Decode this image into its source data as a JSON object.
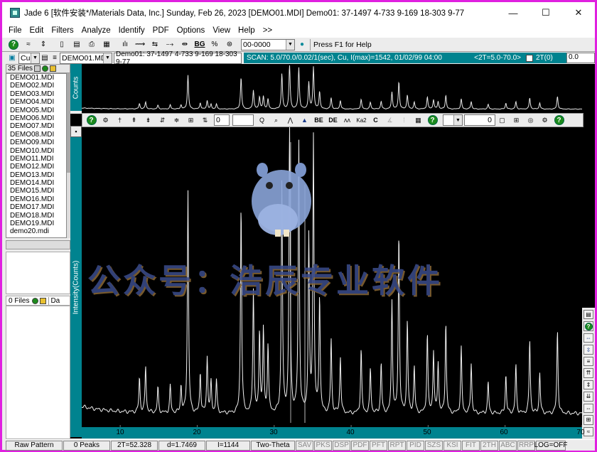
{
  "window": {
    "title": "Jade 6 [软件安装*/Materials Data, Inc.] Sunday, Feb 26, 2023 [DEMO01.MDI] Demo01: 37-1497 4-733 9-169 18-303 9-77",
    "minimize_glyph": "—",
    "maximize_glyph": "☐",
    "close_glyph": "✕"
  },
  "menu": [
    "File",
    "Edit",
    "Filters",
    "Analyze",
    "Identify",
    "PDF",
    "Options",
    "View",
    "Help",
    ">>"
  ],
  "toolbar1": {
    "pdf_combo": "00-0000",
    "hint": "Press F1 for Help",
    "button_glyphs": [
      "?",
      "≈",
      "⇕",
      "▯",
      "▤",
      "⎙",
      "▦",
      "ılı",
      "⟿",
      "⇆",
      "⤍",
      "⇹",
      "BG",
      "%",
      "⊛"
    ],
    "icons": [
      "help-icon",
      "smooth-icon",
      "zoom-vert-icon",
      "eraser-icon",
      "film-icon",
      "print-icon",
      "save-icon",
      "bar-peaks-icon",
      "fit-icon",
      "strip-icon",
      "shift-icon",
      "expand-icon",
      "background-icon",
      "percent-icon",
      "globe-icon"
    ]
  },
  "toolbar2": {
    "target": "Cu",
    "file_combo": "DEMO01.MDI",
    "header_text": "Demo01: 37-1497 4-733 9-169 18-303 9-77",
    "scan_text": "SCAN: 5.0/70.0/0.02/1(sec), Cu, I(max)=1542, 01/02/99 04:00",
    "range_text": "<2T=5.0-70.0>",
    "twotheta_label": "2T(0)",
    "twotheta_value": "0.0"
  },
  "files": {
    "count_label": "35 Files",
    "items": [
      "DEMO01.MDI",
      "DEMO02.MDI",
      "DEMO03.MDI",
      "DEMO04.MDI",
      "DEMO05.MDI",
      "DEMO06.MDI",
      "DEMO07.MDI",
      "DEMO08.MDI",
      "DEMO09.MDI",
      "DEMO10.MDI",
      "DEMO11.MDI",
      "DEMO12.MDI",
      "DEMO13.MDI",
      "DEMO14.MDI",
      "DEMO15.MDI",
      "DEMO16.MDI",
      "DEMO17.MDI",
      "DEMO18.MDI",
      "DEMO19.MDI",
      "demo20.mdi"
    ],
    "files2_label": "0 Files",
    "files2_col": "Da"
  },
  "chart_toolbar": {
    "value_box": "0",
    "value_box2": "0",
    "button_labels": [
      "",
      "",
      "",
      "",
      "",
      "",
      "",
      "",
      "",
      "",
      "",
      "BE",
      "DE",
      "",
      "Ka2",
      "C",
      "",
      "",
      "?"
    ]
  },
  "chart": {
    "overview_ylabel": "Counts",
    "main_ylabel": "Intensity(Counts)",
    "x_ticks": [
      "10",
      "20",
      "30",
      "40",
      "50",
      "60",
      "70"
    ]
  },
  "chart_data": {
    "type": "line",
    "title": "",
    "xlabel": "",
    "ylabel": "Intensity(Counts)",
    "xlim": [
      5,
      70
    ],
    "ylim": [
      0,
      1542
    ],
    "x_ticks": [
      10,
      20,
      30,
      40,
      50,
      60,
      70
    ],
    "peaks_2theta": [
      12.5,
      13.3,
      14.9,
      16.5,
      17.9,
      18.8,
      20.4,
      21.3,
      21.8,
      22.5,
      25.7,
      27.3,
      28.1,
      28.6,
      29.2,
      31.0,
      32.0,
      33.2,
      34.5,
      35.1,
      35.9,
      37.4,
      38.6,
      41.3,
      42.5,
      43.9,
      45.3,
      46.2,
      47.3,
      48.2,
      49.9,
      50.7,
      51.3,
      52.3,
      54.3,
      55.6,
      57.8,
      60.1,
      61.4,
      63.2,
      64.5,
      66.8
    ],
    "peaks_intensity": [
      180,
      240,
      130,
      140,
      140,
      1150,
      210,
      290,
      160,
      170,
      1080,
      640,
      420,
      430,
      350,
      1200,
      1542,
      1400,
      900,
      1420,
      600,
      380,
      290,
      330,
      230,
      260,
      580,
      930,
      480,
      240,
      410,
      320,
      260,
      470,
      340,
      260,
      160,
      200,
      250,
      380,
      210,
      430
    ],
    "background_level": 60,
    "series": [
      {
        "name": "",
        "x_range": [
          5,
          70
        ]
      }
    ]
  },
  "right_tools": [
    "rt1",
    "?",
    "⇔",
    "⇱",
    "≡",
    "⇈",
    "⇕",
    "⇊",
    "⇔",
    "⊞",
    "≈"
  ],
  "status": {
    "mode": "Raw Pattern",
    "peaks": "0 Peaks",
    "twotheta": "2T=52.328",
    "dspacing": "d=1.7469",
    "intensity": "I=1144",
    "axis_mode": "Two-Theta",
    "tags": [
      "SAV",
      "PKS",
      "DSP",
      "PDF",
      "PFT",
      "RPT",
      "PID",
      "SZS",
      "KSI",
      "FIT",
      "2TH",
      "ABC",
      "RRP"
    ],
    "log": "LOG=OFF"
  },
  "watermark": "公众号：浩辰专业软件"
}
